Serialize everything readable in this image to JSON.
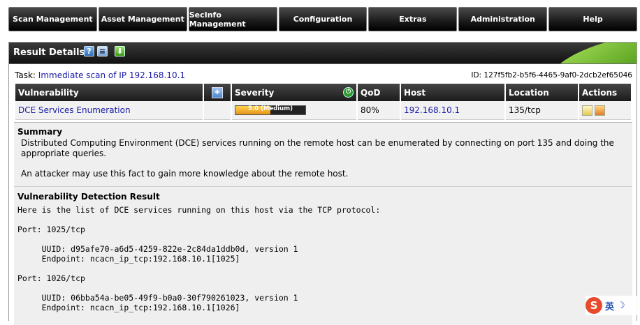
{
  "menu": [
    "Scan Management",
    "Asset Management",
    "SecInfo Management",
    "Configuration",
    "Extras",
    "Administration",
    "Help"
  ],
  "panel": {
    "title": "Result Details"
  },
  "task": {
    "label": "Task:",
    "name": "Immediate scan of IP 192.168.10.1",
    "id": "ID: 127f5fb2-b5f6-4465-9af0-2dcb2ef65046"
  },
  "table": {
    "headers": {
      "vulnerability": "Vulnerability",
      "severity": "Severity",
      "qod": "QoD",
      "host": "Host",
      "location": "Location",
      "actions": "Actions"
    },
    "row": {
      "name": "DCE Services Enumeration",
      "severity_label": "5.0 (Medium)",
      "severity_fraction": 0.5,
      "qod": "80%",
      "host": "192.168.10.1",
      "location": "135/tcp"
    }
  },
  "summary": {
    "heading": "Summary",
    "p1": "Distributed Computing Environment (DCE) services running on the remote host can be enumerated by connecting on port 135 and doing the appropriate queries.",
    "p2": "An attacker may use this fact to gain more knowledge about the remote host."
  },
  "detection": {
    "heading": "Vulnerability Detection Result",
    "body": "Here is the list of DCE services running on this host via the TCP protocol:\n\nPort: 1025/tcp\n\n     UUID: d95afe70-a6d5-4259-822e-2c84da1ddb0d, version 1\n     Endpoint: ncacn_ip_tcp:192.168.10.1[1025]\n\nPort: 1026/tcp\n\n     UUID: 06bba54a-be05-49f9-b0a0-30f790261023, version 1\n     Endpoint: ncacn_ip_tcp:192.168.10.1[1026]"
  },
  "ime": {
    "logo": "S",
    "lang": "英",
    "moon": "☽"
  }
}
